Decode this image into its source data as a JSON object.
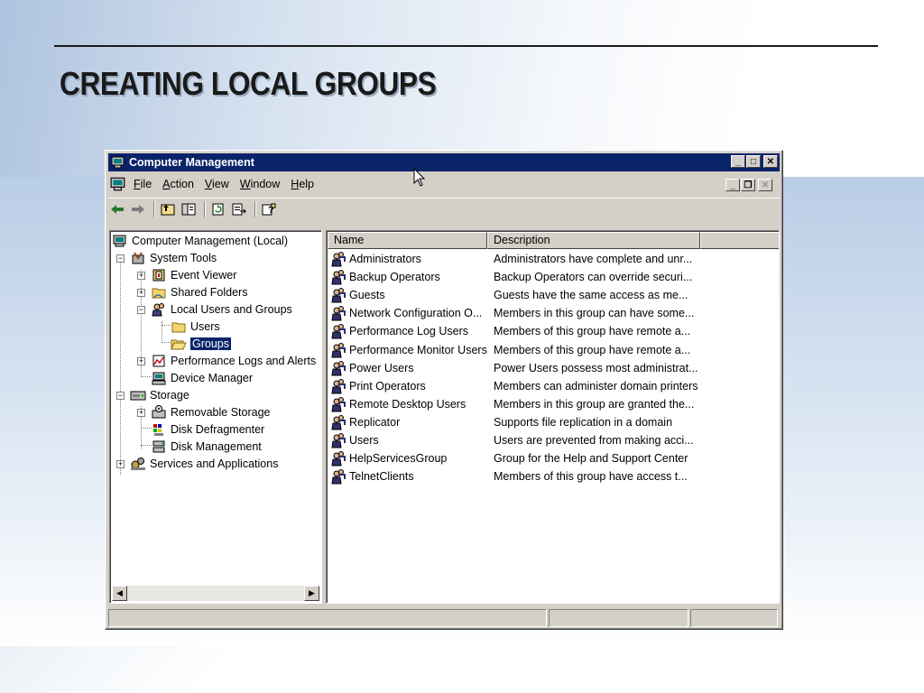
{
  "slide": {
    "title": "CREATING LOCAL GROUPS"
  },
  "window": {
    "title": "Computer Management",
    "menu": [
      {
        "label": "File",
        "key": "F",
        "rest": "ile"
      },
      {
        "label": "Action",
        "key": "A",
        "rest": "ction"
      },
      {
        "label": "View",
        "key": "V",
        "rest": "iew"
      },
      {
        "label": "Window",
        "key": "W",
        "rest": "indow"
      },
      {
        "label": "Help",
        "key": "H",
        "rest": "elp"
      }
    ]
  },
  "tree": {
    "root": "Computer Management (Local)",
    "system_tools": "System Tools",
    "event_viewer": "Event Viewer",
    "shared_folders": "Shared Folders",
    "local_users_groups": "Local Users and Groups",
    "users": "Users",
    "groups": "Groups",
    "perf_logs": "Performance Logs and Alerts",
    "device_manager": "Device Manager",
    "storage": "Storage",
    "removable_storage": "Removable Storage",
    "disk_defrag": "Disk Defragmenter",
    "disk_management": "Disk Management",
    "services_apps": "Services and Applications"
  },
  "list": {
    "columns": [
      "Name",
      "Description"
    ],
    "rows": [
      {
        "name": "Administrators",
        "description": "Administrators have complete and unr..."
      },
      {
        "name": "Backup Operators",
        "description": "Backup Operators can override securi..."
      },
      {
        "name": "Guests",
        "description": "Guests have the same access as me..."
      },
      {
        "name": "Network Configuration O...",
        "description": "Members in this group can have some..."
      },
      {
        "name": "Performance Log Users",
        "description": "Members of this group have remote a..."
      },
      {
        "name": "Performance Monitor Users",
        "description": "Members of this group have remote a..."
      },
      {
        "name": "Power Users",
        "description": "Power Users possess most administrat..."
      },
      {
        "name": "Print Operators",
        "description": "Members can administer domain printers"
      },
      {
        "name": "Remote Desktop Users",
        "description": "Members in this group are granted the..."
      },
      {
        "name": "Replicator",
        "description": "Supports file replication in a domain"
      },
      {
        "name": "Users",
        "description": "Users are prevented from making acci..."
      },
      {
        "name": "HelpServicesGroup",
        "description": "Group for the Help and Support Center"
      },
      {
        "name": "TelnetClients",
        "description": "Members of this group have access t..."
      }
    ]
  },
  "colors": {
    "titlebar": "#0a246a",
    "face": "#d4d0c8",
    "selection": "#0a246a"
  }
}
